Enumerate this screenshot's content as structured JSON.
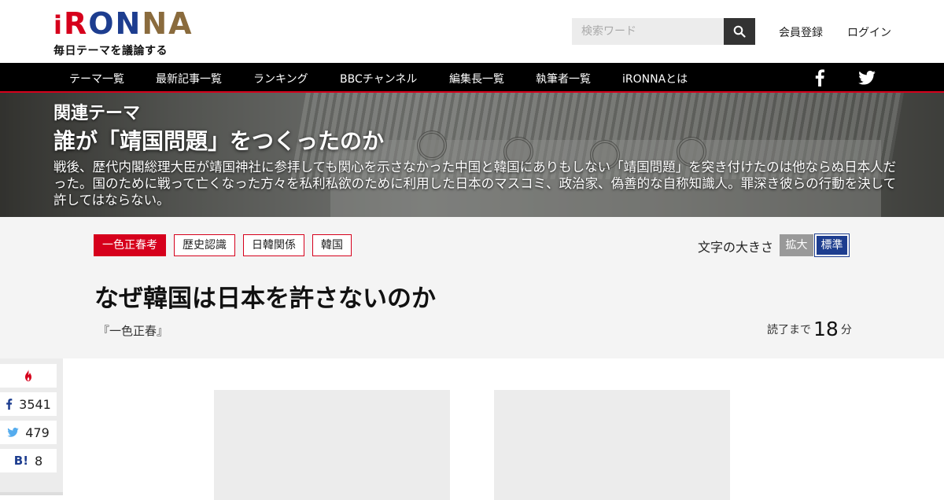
{
  "header": {
    "logo": {
      "letters": [
        "i",
        "R",
        "O",
        "N",
        "N",
        "A"
      ],
      "tagline": "毎日テーマを議論する"
    },
    "search": {
      "placeholder": "検索ワード",
      "icon": "search-icon"
    },
    "links": {
      "register": "会員登録",
      "login": "ログイン"
    }
  },
  "nav": {
    "items": [
      "テーマ一覧",
      "最新記事一覧",
      "ランキング",
      "BBCチャンネル",
      "編集長一覧",
      "執筆者一覧",
      "iRONNAとは"
    ],
    "social": [
      "facebook-icon",
      "twitter-icon"
    ]
  },
  "hero": {
    "kicker": "関連テーマ",
    "title": "誰が「靖国問題」をつくったのか",
    "description": "戦後、歴代内閣総理大臣が靖国神社に参拝しても関心を示さなかった中国と韓国にありもしない「靖国問題」を突き付けたのは他ならぬ日本人だった。国のために戦って亡くなった方々を私利私欲のために利用した日本のマスコミ、政治家、偽善的な自称知識人。罪深き彼らの行動を決して許してはならない。"
  },
  "article": {
    "tags": [
      "一色正春考",
      "歴史認識",
      "日韓関係",
      "韓国"
    ],
    "font_size": {
      "label": "文字の大きさ",
      "large": "拡大",
      "normal": "標準"
    },
    "title": "なぜ韓国は日本を許さないのか",
    "author": "『一色正春』",
    "read_time": {
      "prefix": "読了まで",
      "minutes": "18",
      "suffix": "分"
    }
  },
  "share": {
    "hot_icon": "fire-icon",
    "facebook_count": "3541",
    "twitter_count": "479",
    "hatena_label": "B!",
    "hatena_count": "8"
  },
  "colors": {
    "brand_red": "#d6001c",
    "brand_blue": "#1d3d8f",
    "brand_gold": "#8a6b3d",
    "nav_bg": "#000000"
  }
}
